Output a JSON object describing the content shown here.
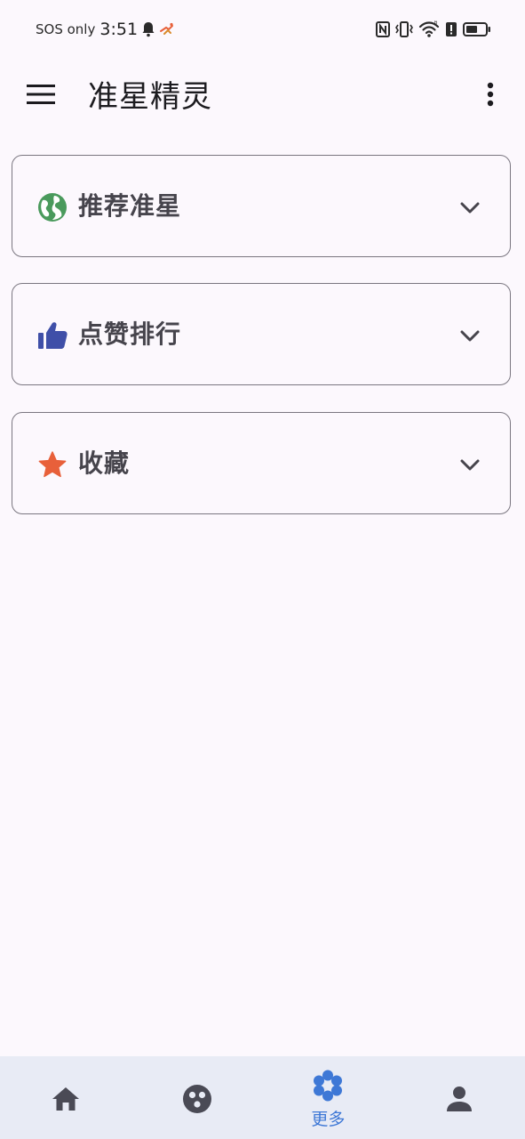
{
  "status_bar": {
    "sos": "SOS only",
    "time": "3:51",
    "icons": [
      "bell-icon",
      "runner-icon",
      "nfc-icon",
      "vibrate-icon",
      "wifi-icon",
      "alert-icon",
      "battery-icon"
    ]
  },
  "app_bar": {
    "title": "准星精灵",
    "menu_icon": "hamburger-menu-icon",
    "overflow_icon": "more-vert-icon"
  },
  "sections": [
    {
      "label": "推荐准星",
      "icon": "globe-icon",
      "icon_color": "#4a9a5c",
      "expanded": false
    },
    {
      "label": "点赞排行",
      "icon": "thumb-up-icon",
      "icon_color": "#3f4fa8",
      "expanded": false
    },
    {
      "label": "收藏",
      "icon": "star-icon",
      "icon_color": "#e8603a",
      "expanded": false
    }
  ],
  "bottom_nav": {
    "items": [
      {
        "icon": "home-icon",
        "label": "",
        "active": false
      },
      {
        "icon": "circles-icon",
        "label": "",
        "active": false
      },
      {
        "icon": "flower-icon",
        "label": "更多",
        "active": true
      },
      {
        "icon": "person-icon",
        "label": "",
        "active": false
      }
    ],
    "active_color": "#3e78d6",
    "inactive_color": "#4a4a55"
  },
  "colors": {
    "background": "#fcf8fd",
    "card_border": "#7a7680",
    "nav_background": "#e8ebf5"
  }
}
